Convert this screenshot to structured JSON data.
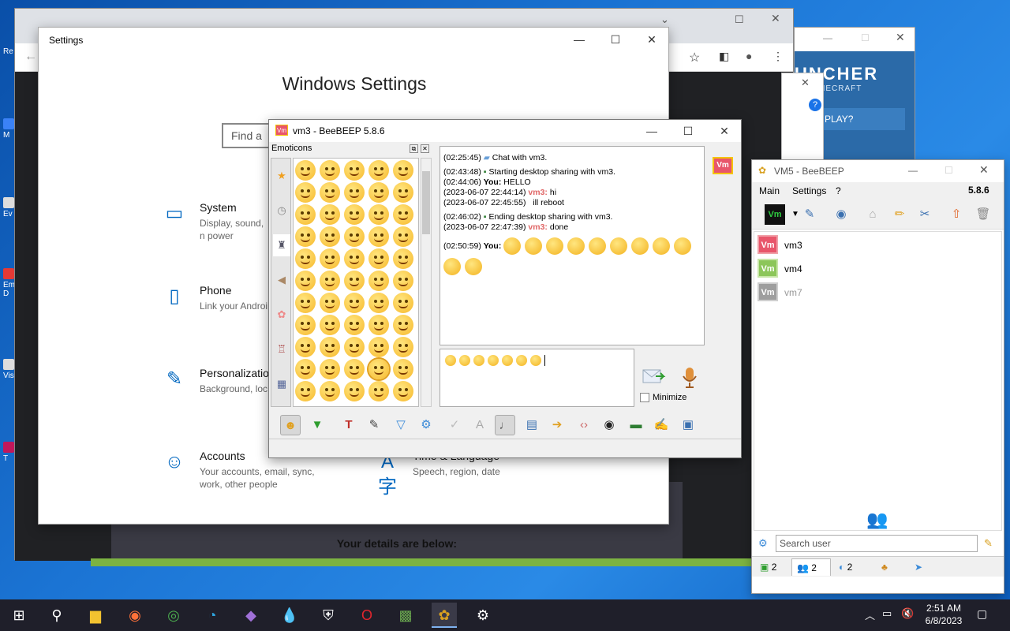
{
  "desktop": {
    "icon_labels": [
      "Re",
      "M",
      "Ev",
      "Em D",
      "Vis",
      "T"
    ]
  },
  "settings": {
    "title": "Settings",
    "heading": "Windows Settings",
    "search_placeholder": "Find a",
    "items": [
      {
        "title": "System",
        "desc": "Display, sound, n power"
      },
      {
        "title": "Phone",
        "desc": "Link your Androi"
      },
      {
        "title": "Personalization",
        "desc": "Background, loc"
      },
      {
        "title": "Accounts",
        "desc": "Your accounts, email, sync, work, other people"
      },
      {
        "title": "Time & Language",
        "desc": "Speech, region, date"
      }
    ]
  },
  "chrome": {
    "page_text": "Your details are below:"
  },
  "launcher": {
    "brand": "UNCHER",
    "sub": "R MINECRAFT",
    "play": "PLAY?"
  },
  "vm3_window": {
    "title": "vm3 - BeeBEEP 5.8.6",
    "emoticons_label": "Emoticons",
    "badge": "Vm",
    "chat": [
      {
        "time": "(02:25:45)",
        "text": "Chat with vm3."
      },
      {
        "time": "(02:43:48)",
        "text": "Starting desktop sharing with vm3."
      },
      {
        "time": "(02:44:06)",
        "who": "You:",
        "text": "HELLO"
      },
      {
        "time": "(2023-06-07 22:44:14)",
        "who": "vm3:",
        "text": "hi"
      },
      {
        "time": "(2023-06-07 22:45:55)",
        "text": "ill reboot"
      },
      {
        "time": "(02:46:02)",
        "text": "Ending desktop sharing with vm3."
      },
      {
        "time": "(2023-06-07 22:47:39)",
        "who": "vm3:",
        "text": "done"
      },
      {
        "time": "(02:50:59)",
        "who": "You:",
        "text": ""
      }
    ],
    "minimize_label": "Minimize"
  },
  "vm5_window": {
    "title": "VM5 - BeeBEEP",
    "menu": [
      "Main",
      "Settings",
      "?"
    ],
    "version": "5.8.6",
    "users": [
      {
        "badge": "Vm",
        "name": "vm3",
        "color": "#e8566b",
        "border": "#f0a0a8"
      },
      {
        "badge": "Vm",
        "name": "vm4",
        "color": "#8cc65a",
        "border": "#c8e6a8"
      },
      {
        "badge": "Vm",
        "name": "vm7",
        "color": "#9e9e9e",
        "border": "#cfcfcf"
      }
    ],
    "search_placeholder": "Search user",
    "tabs": [
      "2",
      "2",
      "2"
    ]
  },
  "taskbar": {
    "time": "2:51 AM",
    "date": "6/8/2023"
  }
}
